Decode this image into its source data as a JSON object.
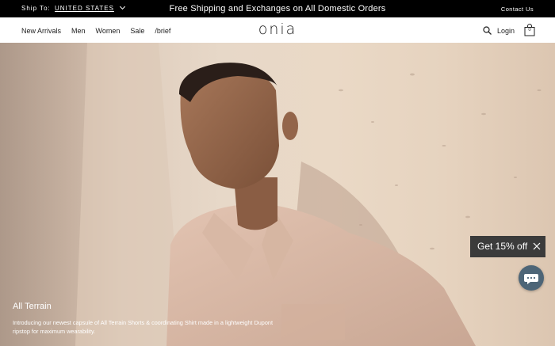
{
  "topbar": {
    "ship_label": "Ship To:",
    "ship_country": "UNITED STATES",
    "promo": "Free Shipping and Exchanges on All Domestic Orders",
    "contact": "Contact Us"
  },
  "nav": {
    "links": [
      "New Arrivals",
      "Men",
      "Women",
      "Sale",
      "/brief"
    ],
    "logo": "onia",
    "login": "Login",
    "bag_count": "0"
  },
  "hero": {
    "title": "All Terrain",
    "description": "Introducing our newest capsule of All Terrain Shorts & coordinating Shirt made in a lightweight Dupont ripstop for maximum wearability."
  },
  "popup": {
    "discount_label": "Get 15% off"
  },
  "icons": {
    "search": "search-icon",
    "bag": "shopping-bag-icon",
    "close": "close-icon",
    "chat": "chat-icon",
    "chevron": "chevron-down-icon"
  },
  "colors": {
    "topbar_bg": "#000000",
    "popup_bg": "#3b3b3b",
    "chat_bg": "#4d6577"
  }
}
